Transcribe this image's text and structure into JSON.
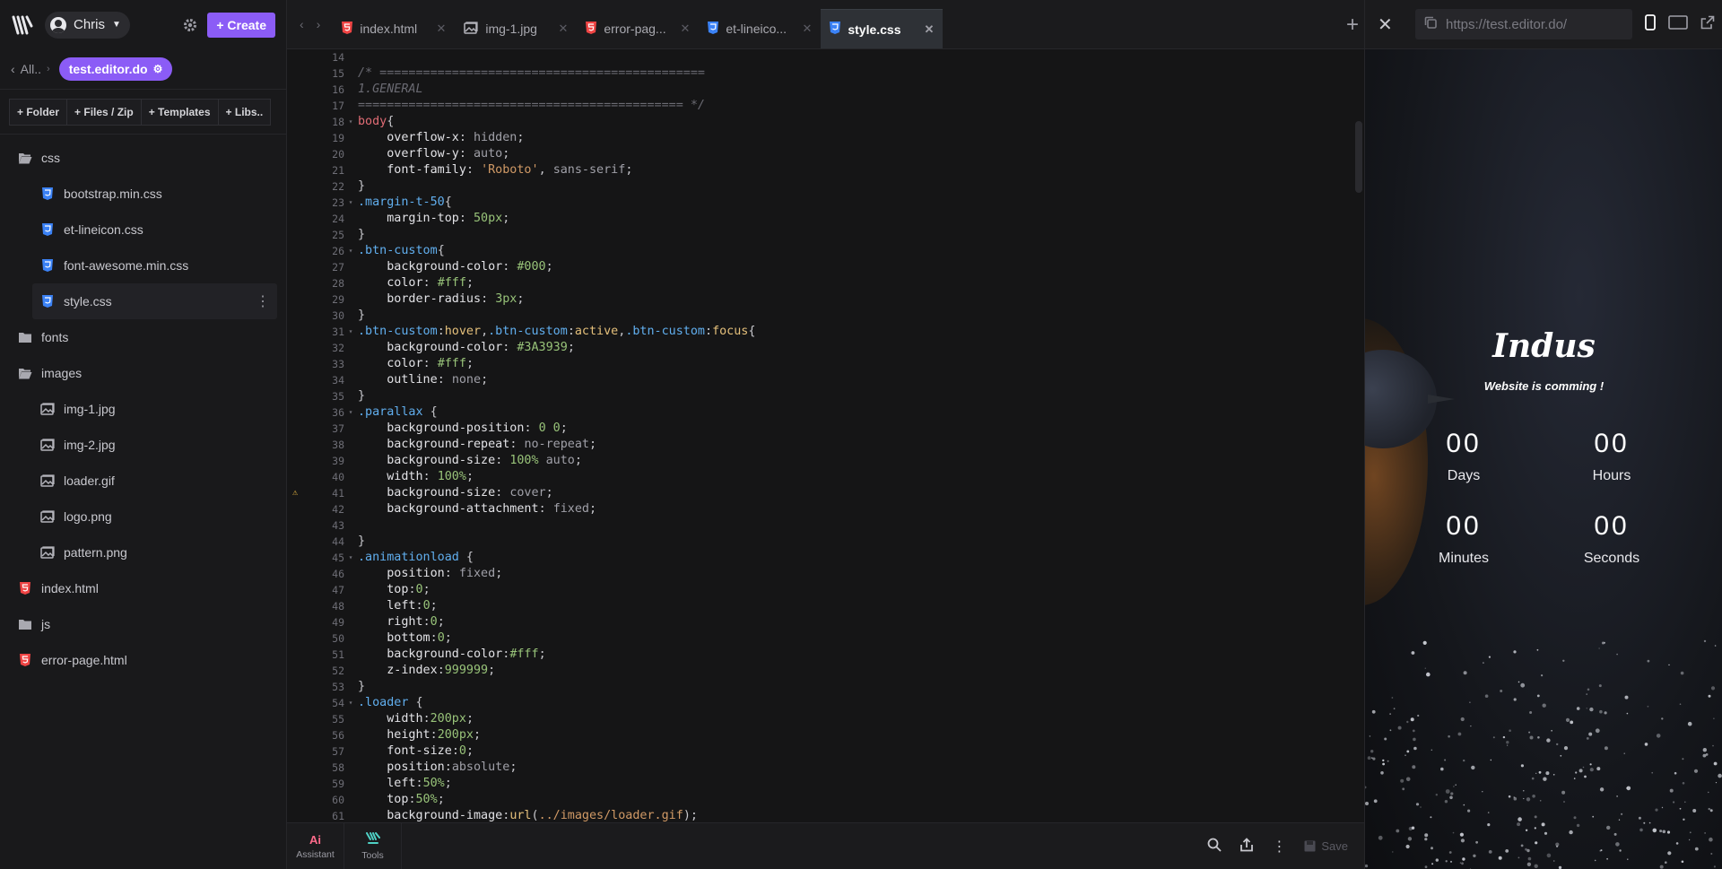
{
  "sidebar": {
    "user_name": "Chris",
    "create_label": "+ Create",
    "crumb_back": "All..",
    "project_name": "test.editor.do",
    "actions": [
      "+ Folder",
      "+ Files / Zip",
      "+ Templates",
      "+ Libs.."
    ],
    "tree": [
      {
        "name": "css",
        "type": "folder-open",
        "level": 0
      },
      {
        "name": "bootstrap.min.css",
        "type": "css",
        "level": 1
      },
      {
        "name": "et-lineicon.css",
        "type": "css",
        "level": 1
      },
      {
        "name": "font-awesome.min.css",
        "type": "css",
        "level": 1
      },
      {
        "name": "style.css",
        "type": "css",
        "level": 1,
        "active": true
      },
      {
        "name": "fonts",
        "type": "folder",
        "level": 0
      },
      {
        "name": "images",
        "type": "folder-open",
        "level": 0
      },
      {
        "name": "img-1.jpg",
        "type": "image",
        "level": 1
      },
      {
        "name": "img-2.jpg",
        "type": "image",
        "level": 1
      },
      {
        "name": "loader.gif",
        "type": "image",
        "level": 1
      },
      {
        "name": "logo.png",
        "type": "image",
        "level": 1
      },
      {
        "name": "pattern.png",
        "type": "image",
        "level": 1
      },
      {
        "name": "index.html",
        "type": "html",
        "level": 0
      },
      {
        "name": "js",
        "type": "folder",
        "level": 0
      },
      {
        "name": "error-page.html",
        "type": "html",
        "level": 0
      }
    ]
  },
  "tabs": [
    {
      "label": "index.html",
      "type": "html"
    },
    {
      "label": "img-1.jpg",
      "type": "image"
    },
    {
      "label": "error-pag...",
      "type": "html"
    },
    {
      "label": "et-lineico...",
      "type": "css"
    },
    {
      "label": "style.css",
      "type": "css",
      "active": true
    }
  ],
  "code": {
    "first_line": 14,
    "warning_line": 41,
    "lines": [
      [],
      [
        [
          "com",
          "/* ============================================="
        ]
      ],
      [
        [
          "com",
          "1.GENERAL"
        ]
      ],
      [
        [
          "com",
          "============================================= */"
        ]
      ],
      [
        [
          "sel",
          "body"
        ],
        [
          "pn",
          "{"
        ]
      ],
      [
        [
          "pn",
          "    "
        ],
        [
          "prop",
          "overflow-x"
        ],
        [
          "pn",
          ": "
        ],
        [
          "val",
          "hidden"
        ],
        [
          "pn",
          ";"
        ]
      ],
      [
        [
          "pn",
          "    "
        ],
        [
          "prop",
          "overflow-y"
        ],
        [
          "pn",
          ": "
        ],
        [
          "val",
          "auto"
        ],
        [
          "pn",
          ";"
        ]
      ],
      [
        [
          "pn",
          "    "
        ],
        [
          "prop",
          "font-family"
        ],
        [
          "pn",
          ": "
        ],
        [
          "str",
          "'Roboto'"
        ],
        [
          "pn",
          ", "
        ],
        [
          "val",
          "sans-serif"
        ],
        [
          "pn",
          ";"
        ]
      ],
      [
        [
          "pn",
          "}"
        ]
      ],
      [
        [
          "cls",
          ".margin-t-50"
        ],
        [
          "pn",
          "{"
        ]
      ],
      [
        [
          "pn",
          "    "
        ],
        [
          "prop",
          "margin-top"
        ],
        [
          "pn",
          ": "
        ],
        [
          "num",
          "50px"
        ],
        [
          "pn",
          ";"
        ]
      ],
      [
        [
          "pn",
          "}"
        ]
      ],
      [
        [
          "cls",
          ".btn-custom"
        ],
        [
          "pn",
          "{"
        ]
      ],
      [
        [
          "pn",
          "    "
        ],
        [
          "prop",
          "background-color"
        ],
        [
          "pn",
          ": "
        ],
        [
          "num",
          "#000"
        ],
        [
          "pn",
          ";"
        ]
      ],
      [
        [
          "pn",
          "    "
        ],
        [
          "prop",
          "color"
        ],
        [
          "pn",
          ": "
        ],
        [
          "num",
          "#fff"
        ],
        [
          "pn",
          ";"
        ]
      ],
      [
        [
          "pn",
          "    "
        ],
        [
          "prop",
          "border-radius"
        ],
        [
          "pn",
          ": "
        ],
        [
          "num",
          "3px"
        ],
        [
          "pn",
          ";"
        ]
      ],
      [
        [
          "pn",
          "}"
        ]
      ],
      [
        [
          "cls",
          ".btn-custom"
        ],
        [
          "pn",
          ":"
        ],
        [
          "fn",
          "hover"
        ],
        [
          "pn",
          ","
        ],
        [
          "cls",
          ".btn-custom"
        ],
        [
          "pn",
          ":"
        ],
        [
          "fn",
          "active"
        ],
        [
          "pn",
          ","
        ],
        [
          "cls",
          ".btn-custom"
        ],
        [
          "pn",
          ":"
        ],
        [
          "fn",
          "focus"
        ],
        [
          "pn",
          "{"
        ]
      ],
      [
        [
          "pn",
          "    "
        ],
        [
          "prop",
          "background-color"
        ],
        [
          "pn",
          ": "
        ],
        [
          "num",
          "#3A3939"
        ],
        [
          "pn",
          ";"
        ]
      ],
      [
        [
          "pn",
          "    "
        ],
        [
          "prop",
          "color"
        ],
        [
          "pn",
          ": "
        ],
        [
          "num",
          "#fff"
        ],
        [
          "pn",
          ";"
        ]
      ],
      [
        [
          "pn",
          "    "
        ],
        [
          "prop",
          "outline"
        ],
        [
          "pn",
          ": "
        ],
        [
          "val",
          "none"
        ],
        [
          "pn",
          ";"
        ]
      ],
      [
        [
          "pn",
          "}"
        ]
      ],
      [
        [
          "cls",
          ".parallax"
        ],
        [
          "pn",
          " {"
        ]
      ],
      [
        [
          "pn",
          "    "
        ],
        [
          "prop",
          "background-position"
        ],
        [
          "pn",
          ": "
        ],
        [
          "num",
          "0 0"
        ],
        [
          "pn",
          ";"
        ]
      ],
      [
        [
          "pn",
          "    "
        ],
        [
          "prop",
          "background-repeat"
        ],
        [
          "pn",
          ": "
        ],
        [
          "val",
          "no-repeat"
        ],
        [
          "pn",
          ";"
        ]
      ],
      [
        [
          "pn",
          "    "
        ],
        [
          "prop",
          "background-size"
        ],
        [
          "pn",
          ": "
        ],
        [
          "num",
          "100%"
        ],
        [
          "pn",
          " "
        ],
        [
          "val",
          "auto"
        ],
        [
          "pn",
          ";"
        ]
      ],
      [
        [
          "pn",
          "    "
        ],
        [
          "prop",
          "width"
        ],
        [
          "pn",
          ": "
        ],
        [
          "num",
          "100%"
        ],
        [
          "pn",
          ";"
        ]
      ],
      [
        [
          "pn",
          "    "
        ],
        [
          "prop",
          "background-size"
        ],
        [
          "pn",
          ": "
        ],
        [
          "val",
          "cover"
        ],
        [
          "pn",
          ";"
        ]
      ],
      [
        [
          "pn",
          "    "
        ],
        [
          "prop",
          "background-attachment"
        ],
        [
          "pn",
          ": "
        ],
        [
          "val",
          "fixed"
        ],
        [
          "pn",
          ";"
        ]
      ],
      [],
      [
        [
          "pn",
          "}"
        ]
      ],
      [
        [
          "cls",
          ".animationload"
        ],
        [
          "pn",
          " {"
        ]
      ],
      [
        [
          "pn",
          "    "
        ],
        [
          "prop",
          "position"
        ],
        [
          "pn",
          ": "
        ],
        [
          "val",
          "fixed"
        ],
        [
          "pn",
          ";"
        ]
      ],
      [
        [
          "pn",
          "    "
        ],
        [
          "prop",
          "top"
        ],
        [
          "pn",
          ":"
        ],
        [
          "num",
          "0"
        ],
        [
          "pn",
          ";"
        ]
      ],
      [
        [
          "pn",
          "    "
        ],
        [
          "prop",
          "left"
        ],
        [
          "pn",
          ":"
        ],
        [
          "num",
          "0"
        ],
        [
          "pn",
          ";"
        ]
      ],
      [
        [
          "pn",
          "    "
        ],
        [
          "prop",
          "right"
        ],
        [
          "pn",
          ":"
        ],
        [
          "num",
          "0"
        ],
        [
          "pn",
          ";"
        ]
      ],
      [
        [
          "pn",
          "    "
        ],
        [
          "prop",
          "bottom"
        ],
        [
          "pn",
          ":"
        ],
        [
          "num",
          "0"
        ],
        [
          "pn",
          ";"
        ]
      ],
      [
        [
          "pn",
          "    "
        ],
        [
          "prop",
          "background-color"
        ],
        [
          "pn",
          ":"
        ],
        [
          "num",
          "#fff"
        ],
        [
          "pn",
          ";"
        ]
      ],
      [
        [
          "pn",
          "    "
        ],
        [
          "prop",
          "z-index"
        ],
        [
          "pn",
          ":"
        ],
        [
          "num",
          "999999"
        ],
        [
          "pn",
          ";"
        ]
      ],
      [
        [
          "pn",
          "}"
        ]
      ],
      [
        [
          "cls",
          ".loader"
        ],
        [
          "pn",
          " {"
        ]
      ],
      [
        [
          "pn",
          "    "
        ],
        [
          "prop",
          "width"
        ],
        [
          "pn",
          ":"
        ],
        [
          "num",
          "200px"
        ],
        [
          "pn",
          ";"
        ]
      ],
      [
        [
          "pn",
          "    "
        ],
        [
          "prop",
          "height"
        ],
        [
          "pn",
          ":"
        ],
        [
          "num",
          "200px"
        ],
        [
          "pn",
          ";"
        ]
      ],
      [
        [
          "pn",
          "    "
        ],
        [
          "prop",
          "font-size"
        ],
        [
          "pn",
          ":"
        ],
        [
          "num",
          "0"
        ],
        [
          "pn",
          ";"
        ]
      ],
      [
        [
          "pn",
          "    "
        ],
        [
          "prop",
          "position"
        ],
        [
          "pn",
          ":"
        ],
        [
          "val",
          "absolute"
        ],
        [
          "pn",
          ";"
        ]
      ],
      [
        [
          "pn",
          "    "
        ],
        [
          "prop",
          "left"
        ],
        [
          "pn",
          ":"
        ],
        [
          "num",
          "50%"
        ],
        [
          "pn",
          ";"
        ]
      ],
      [
        [
          "pn",
          "    "
        ],
        [
          "prop",
          "top"
        ],
        [
          "pn",
          ":"
        ],
        [
          "num",
          "50%"
        ],
        [
          "pn",
          ";"
        ]
      ],
      [
        [
          "pn",
          "    "
        ],
        [
          "prop",
          "background-image"
        ],
        [
          "pn",
          ":"
        ],
        [
          "fn",
          "url"
        ],
        [
          "pn",
          "("
        ],
        [
          "str",
          "../images/loader.gif"
        ],
        [
          "pn",
          ");"
        ]
      ]
    ]
  },
  "bottombar": {
    "assistant_icon": "Ai",
    "assistant_label": "Assistant",
    "tools_label": "Tools",
    "save_label": "Save"
  },
  "preview": {
    "url": "https://test.editor.do/",
    "brand": "Indus",
    "tagline": "Website is comming !",
    "countdown": [
      {
        "value": "00",
        "label": "Days"
      },
      {
        "value": "00",
        "label": "Hours"
      },
      {
        "value": "00",
        "label": "Minutes"
      },
      {
        "value": "00",
        "label": "Seconds"
      }
    ]
  }
}
